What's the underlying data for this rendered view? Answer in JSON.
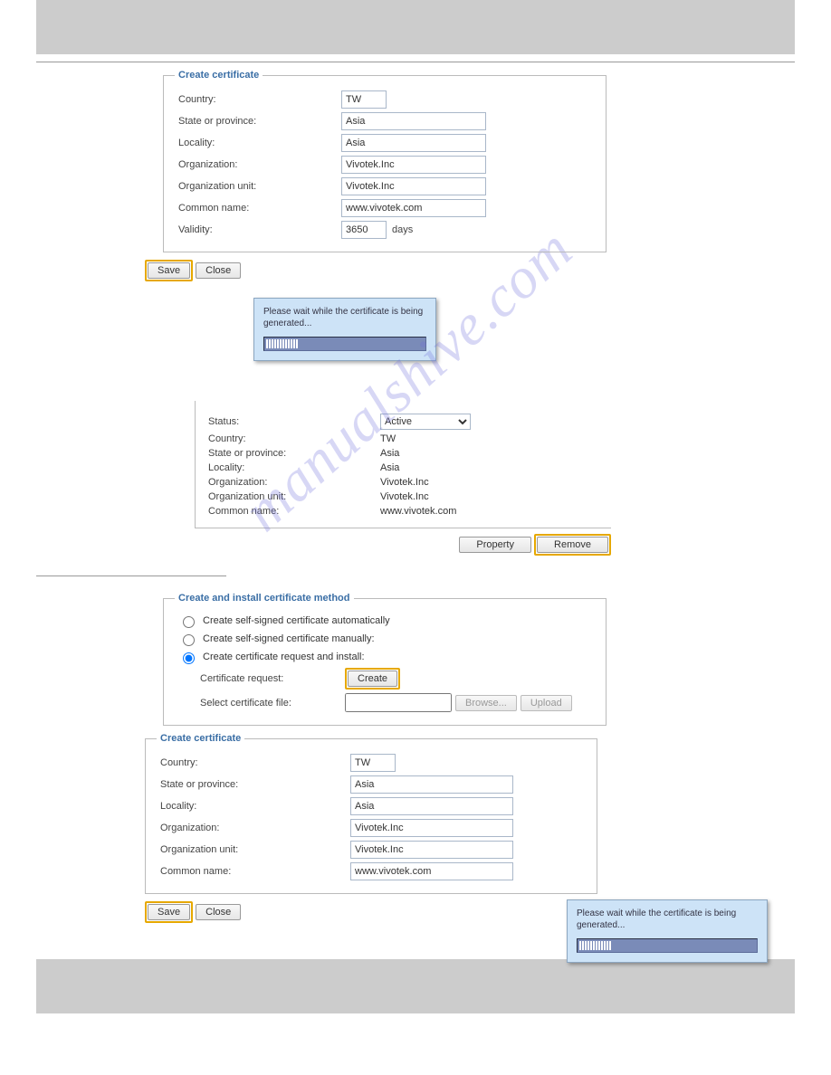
{
  "watermark": "manualshive.com",
  "cert1": {
    "legend": "Create certificate",
    "fields": {
      "country_lbl": "Country:",
      "country_val": "TW",
      "state_lbl": "State or province:",
      "state_val": "Asia",
      "locality_lbl": "Locality:",
      "locality_val": "Asia",
      "org_lbl": "Organization:",
      "org_val": "Vivotek.Inc",
      "orgunit_lbl": "Organization unit:",
      "orgunit_val": "Vivotek.Inc",
      "cn_lbl": "Common name:",
      "cn_val": "www.vivotek.com",
      "validity_lbl": "Validity:",
      "validity_val": "3650",
      "validity_unit": "days"
    },
    "buttons": {
      "save": "Save",
      "close": "Close"
    }
  },
  "wait": {
    "msg": "Please wait while the certificate is being generated..."
  },
  "info": {
    "status_lbl": "Status:",
    "status_val": "Active",
    "country_lbl": "Country:",
    "country_val": "TW",
    "state_lbl": "State or province:",
    "state_val": "Asia",
    "locality_lbl": "Locality:",
    "locality_val": "Asia",
    "org_lbl": "Organization:",
    "org_val": "Vivotek.Inc",
    "orgunit_lbl": "Organization unit:",
    "orgunit_val": "Vivotek.Inc",
    "cn_lbl": "Common name:",
    "cn_val": "www.vivotek.com",
    "property_btn": "Property",
    "remove_btn": "Remove"
  },
  "method": {
    "legend": "Create and install certificate method",
    "opt_auto": "Create self-signed certificate automatically",
    "opt_manual": "Create self-signed certificate manually:",
    "opt_request": "Create certificate request and install:",
    "certreq_lbl": "Certificate request:",
    "create_btn": "Create",
    "selectfile_lbl": "Select certificate file:",
    "browse_btn": "Browse...",
    "upload_btn": "Upload"
  },
  "cert2": {
    "legend": "Create certificate",
    "fields": {
      "country_lbl": "Country:",
      "country_val": "TW",
      "state_lbl": "State or province:",
      "state_val": "Asia",
      "locality_lbl": "Locality:",
      "locality_val": "Asia",
      "org_lbl": "Organization:",
      "org_val": "Vivotek.Inc",
      "orgunit_lbl": "Organization unit:",
      "orgunit_val": "Vivotek.Inc",
      "cn_lbl": "Common name:",
      "cn_val": "www.vivotek.com"
    },
    "buttons": {
      "save": "Save",
      "close": "Close"
    }
  }
}
